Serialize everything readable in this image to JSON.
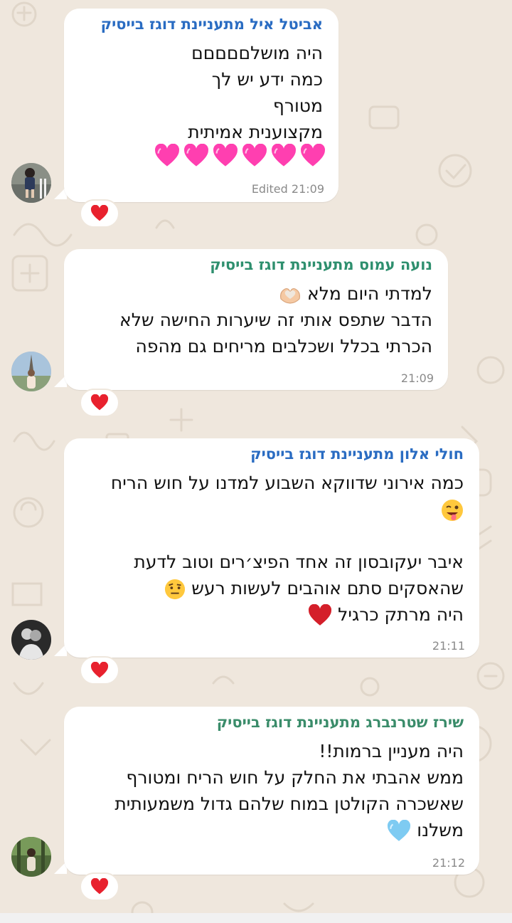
{
  "colors": {
    "chat_background": "#efe7dd",
    "bubble": "#ffffff",
    "reaction_heart": "#e8212e"
  },
  "messages": [
    {
      "sender": "אביטל איל מתעניינת דוגז בייסיק",
      "sender_color": "#2a6cc2",
      "lines": [
        "היה מושלםםםםם",
        "כמה ידע יש לך",
        "מטורף",
        "מקצוענית אמיתית"
      ],
      "emoji_row": "pink-heart-icon x6",
      "time": "Edited 21:09",
      "reaction": "red-heart-icon"
    },
    {
      "sender": "נועה עמוס מתעניינת דוגז בייסיק",
      "sender_color": "#2e8f6e",
      "lines": [
        "למדתי היום מלא",
        "הדבר שתפס אותי זה שיערות החישה שלא",
        "הכרתי בכלל ושכלבים מריחים גם מהפה"
      ],
      "line_emoji": "heart-hands-icon",
      "time": "21:09",
      "reaction": "red-heart-icon"
    },
    {
      "sender": "חולי אלון מתעניינת דוגז בייסיק",
      "sender_color": "#2a6cc2",
      "lines": [
        "כמה אירוני שדווקא השבוע למדנו על חוש הריח",
        "",
        "",
        "איבר יעקובסון זה אחד הפיצ׳רים וטוב לדעת",
        "שהאסקים סתם אוהבים לעשות רעש",
        "היה מרתק כרגיל"
      ],
      "line_emojis": [
        "winking-tongue-face-icon",
        "raised-eyebrow-face-icon",
        "red-heart-icon"
      ],
      "time": "21:11",
      "reaction": "red-heart-icon"
    },
    {
      "sender": "שירז שטרנברג מתעניינת דוגז בייסיק",
      "sender_color": "#3a8c6a",
      "lines": [
        "היה מעניין ברמות!!",
        "ממש אהבתי את החלק על חוש הריח ומטורף",
        "שאשכרה הקולטן במוח שלהם גדול משמעותית",
        "משלנו"
      ],
      "line_emoji": "light-blue-heart-icon",
      "time": "21:12",
      "reaction": "red-heart-icon"
    }
  ]
}
